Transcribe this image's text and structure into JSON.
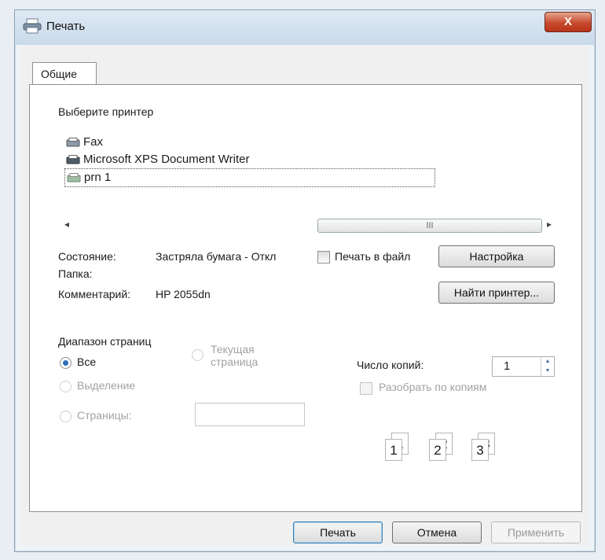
{
  "window": {
    "title": "Печать",
    "close_label": "X"
  },
  "tab": {
    "label": "Общие"
  },
  "printer_section": {
    "label": "Выберите принтер",
    "printers": [
      "Fax",
      "Microsoft XPS Document Writer",
      "prn 1"
    ],
    "scroll_thumb": "III"
  },
  "status": {
    "state_label": "Состояние:",
    "state_value": "Застряла бумага - Откл",
    "folder_label": "Папка:",
    "comment_label": "Комментарий:",
    "comment_value": "HP 2055dn",
    "print_to_file": "Печать в файл",
    "settings_button": "Настройка",
    "find_printer_button": "Найти принтер..."
  },
  "page_range": {
    "label": "Диапазон страниц",
    "all": "Все",
    "current_page_line1": "Текущая",
    "current_page_line2": "страница",
    "selection": "Выделение",
    "pages": "Страницы:"
  },
  "copies": {
    "label": "Число копий:",
    "value": "1",
    "collate": "Разобрать по копиям",
    "preview_pages": [
      "1",
      "1",
      "2",
      "2",
      "3",
      "3"
    ]
  },
  "buttons": {
    "print": "Печать",
    "cancel": "Отмена",
    "apply": "Применить"
  }
}
